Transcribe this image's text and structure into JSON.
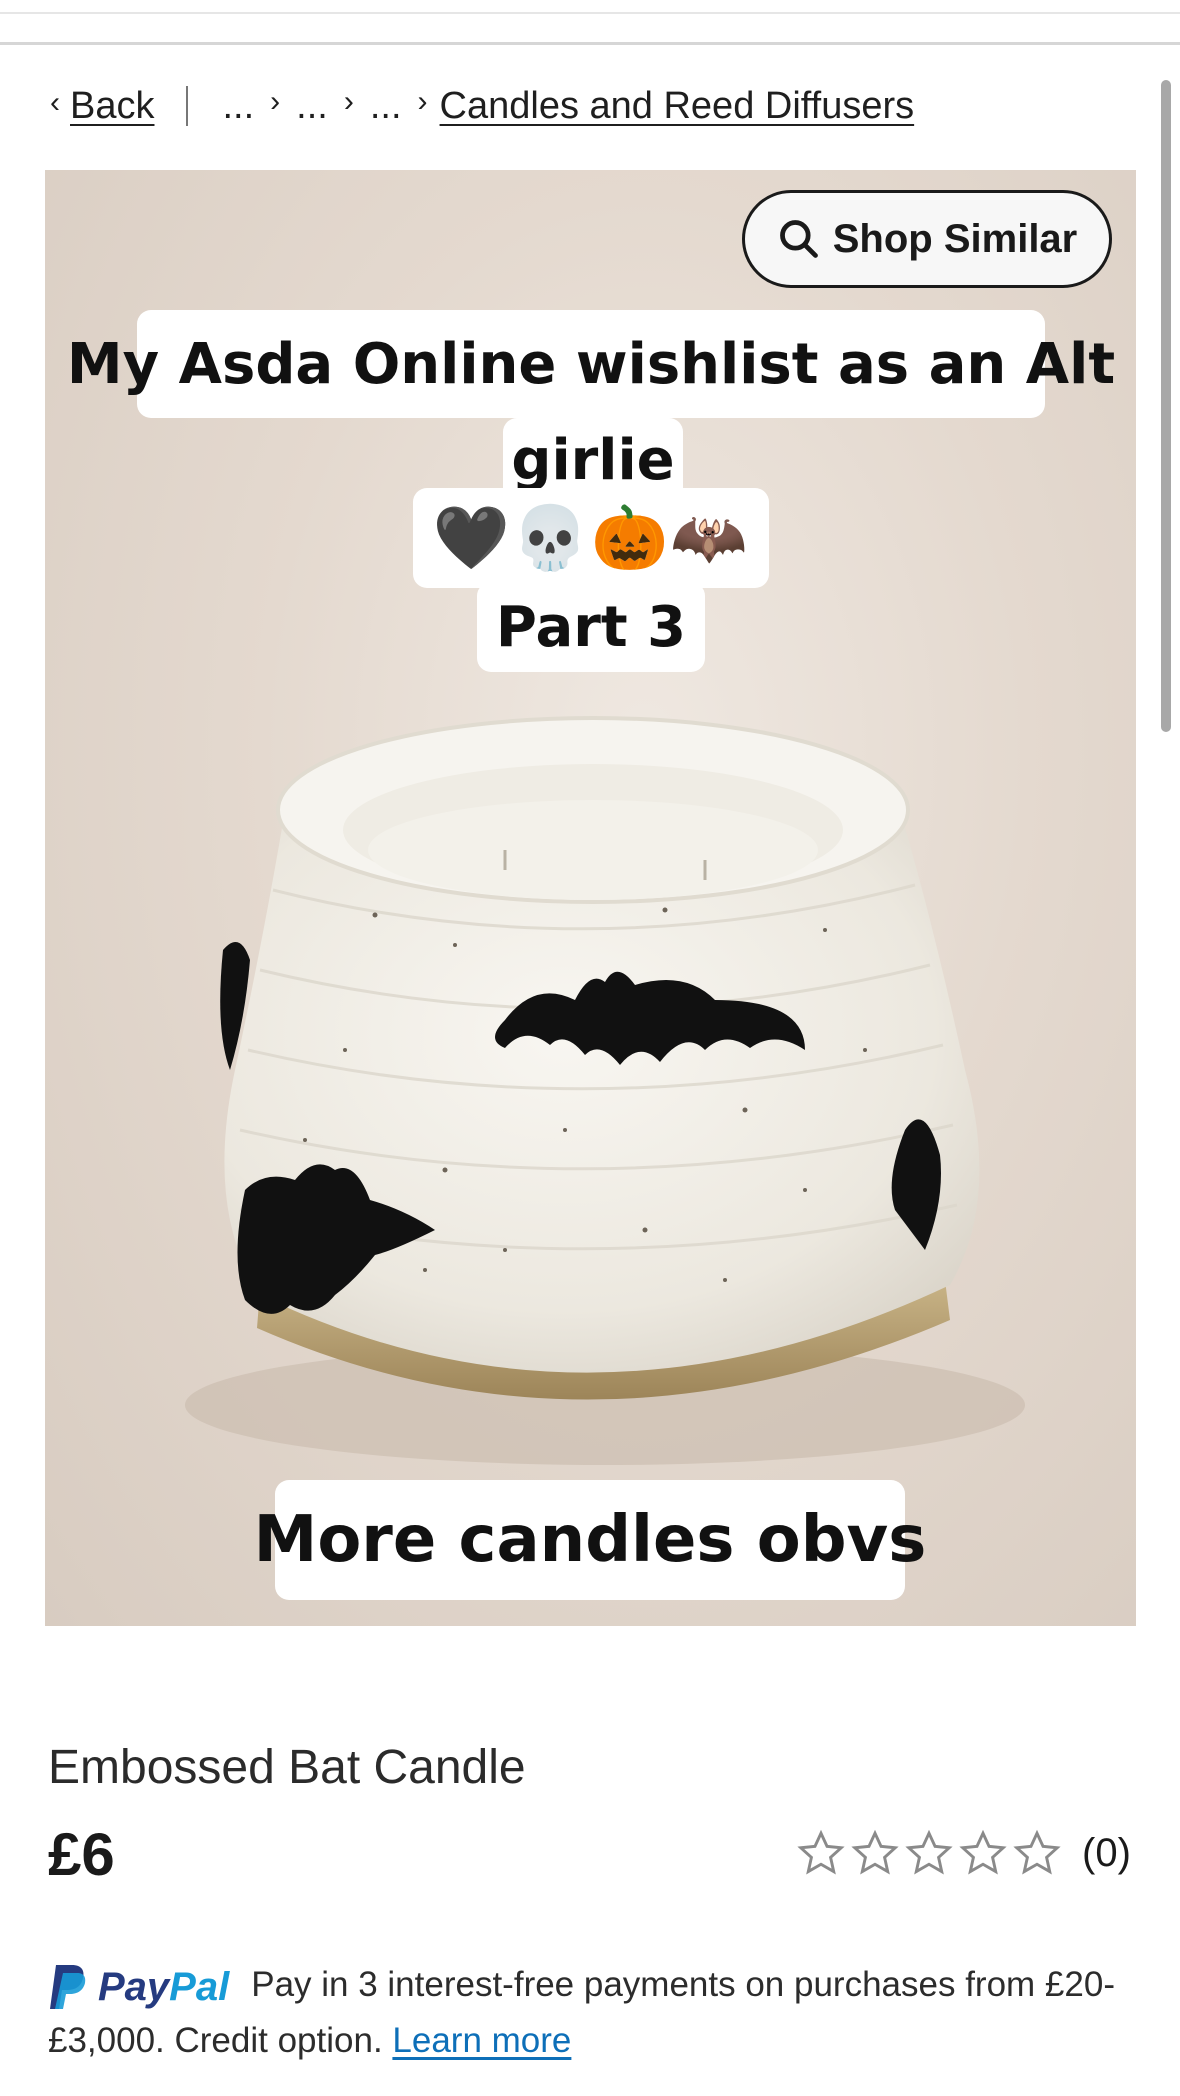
{
  "breadcrumb": {
    "back_label": "Back",
    "ellipsis_1": "...",
    "ellipsis_2": "...",
    "ellipsis_3": "...",
    "current": "Candles and Reed Diffusers"
  },
  "hero": {
    "shop_similar_label": "Shop Similar",
    "caption_line1": "My Asda Online wishlist as an Alt",
    "caption_line2": "girlie",
    "caption_emojis": "🖤💀🎃🦇",
    "caption_line3": "Part 3",
    "caption_bottom": "More candles obvs"
  },
  "product": {
    "title": "Embossed Bat Candle",
    "price": "£6",
    "rating_value": 0,
    "rating_max": 5,
    "review_count": "(0)"
  },
  "paypal": {
    "brand_pay": "Pay",
    "brand_pal": "Pal",
    "message": "Pay in 3 interest-free payments on purchases from £20-£3,000. Credit option.",
    "link_label": "Learn more"
  },
  "colors": {
    "paypal_dark": "#253b80",
    "paypal_light": "#179bd7",
    "link": "#0d6fb8"
  }
}
